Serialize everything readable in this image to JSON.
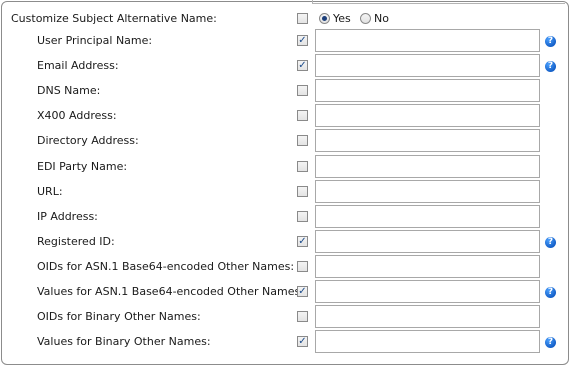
{
  "header": {
    "label": "Customize Subject Alternative Name:",
    "checked": false,
    "options": [
      {
        "label": "Yes",
        "selected": true
      },
      {
        "label": "No",
        "selected": false
      }
    ]
  },
  "fields": [
    {
      "label": "User Principal Name:",
      "checked": true,
      "value": "",
      "help": true
    },
    {
      "label": "Email Address:",
      "checked": true,
      "value": "",
      "help": true
    },
    {
      "label": "DNS Name:",
      "checked": false,
      "value": "",
      "help": false
    },
    {
      "label": "X400 Address:",
      "checked": false,
      "value": "",
      "help": false
    },
    {
      "label": "Directory Address:",
      "checked": false,
      "value": "",
      "help": false
    },
    {
      "label": "EDI Party Name:",
      "checked": false,
      "value": "",
      "help": false
    },
    {
      "label": "URL:",
      "checked": false,
      "value": "",
      "help": false
    },
    {
      "label": "IP Address:",
      "checked": false,
      "value": "",
      "help": false
    },
    {
      "label": "Registered ID:",
      "checked": true,
      "value": "",
      "help": true
    },
    {
      "label": "OIDs for ASN.1 Base64-encoded Other Names:",
      "checked": false,
      "value": "",
      "help": false
    },
    {
      "label": "Values for ASN.1 Base64-encoded Other Names:",
      "checked": true,
      "value": "",
      "help": true
    },
    {
      "label": "OIDs for Binary Other Names:",
      "checked": false,
      "value": "",
      "help": false
    },
    {
      "label": "Values for Binary Other Names:",
      "checked": true,
      "value": "",
      "help": true
    }
  ],
  "icons": {
    "checkmark": "checkmark-icon",
    "help": "help-icon"
  }
}
